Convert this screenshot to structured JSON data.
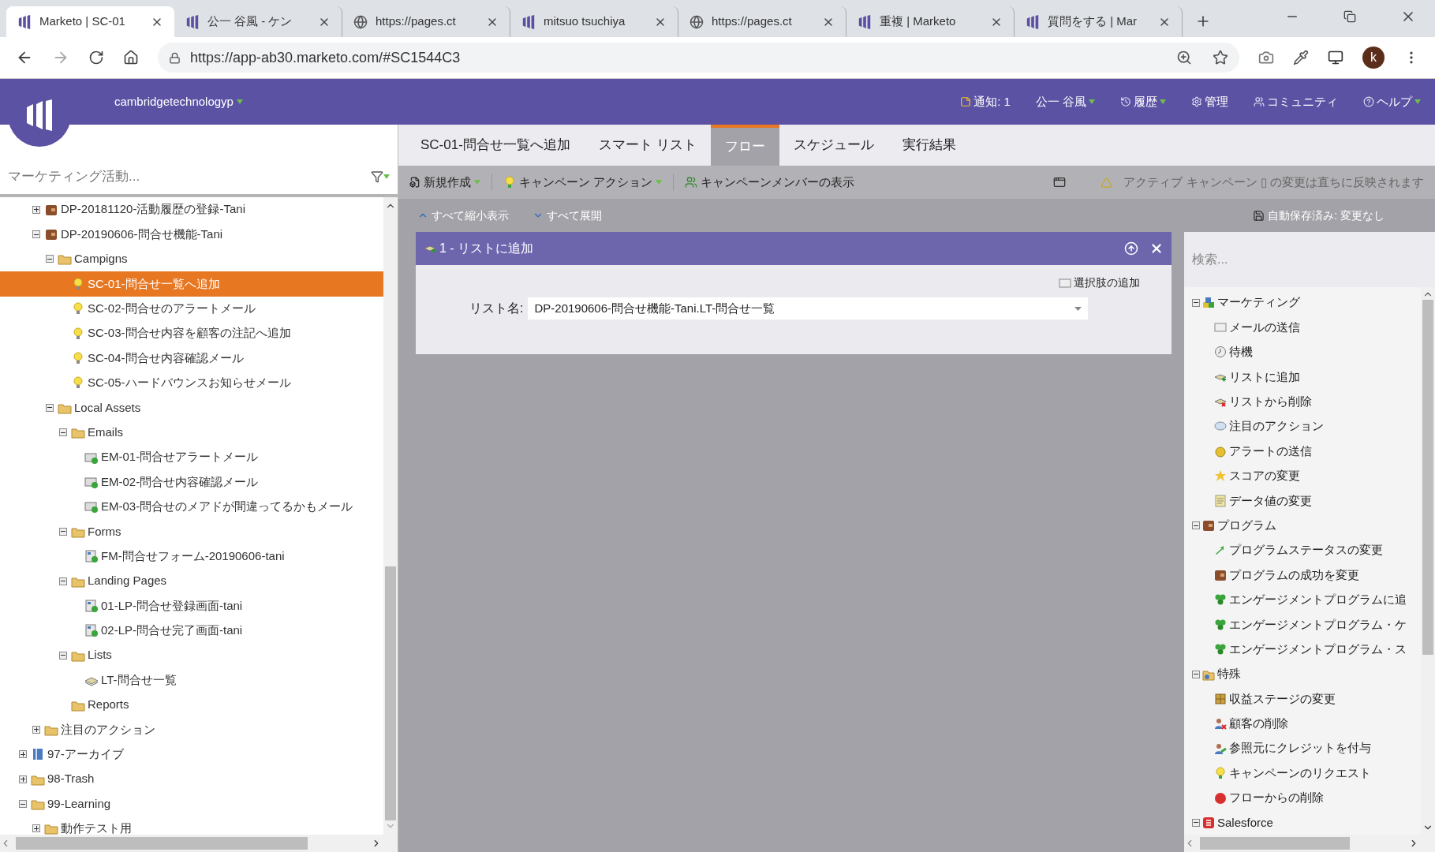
{
  "browser": {
    "tabs": [
      {
        "title": "Marketo | SC-01",
        "kind": "marketo",
        "selected": true
      },
      {
        "title": "公一 谷風 - ケン",
        "kind": "marketo",
        "selected": false
      },
      {
        "title": "https://pages.ct",
        "kind": "web",
        "selected": false
      },
      {
        "title": "mitsuo tsuchiya",
        "kind": "marketo",
        "selected": false
      },
      {
        "title": "https://pages.ct",
        "kind": "web",
        "selected": false
      },
      {
        "title": "重複 | Marketo",
        "kind": "marketo",
        "selected": false
      },
      {
        "title": "質問をする | Mar",
        "kind": "marketo",
        "selected": false
      }
    ],
    "url": "https://app-ab30.marketo.com/#SC1544C3",
    "profile": "k"
  },
  "header": {
    "workspace": "cambridgetechnologyp",
    "menu": [
      {
        "label": "通知: 1",
        "kind": "notifications"
      },
      {
        "label": "公一 谷風",
        "kind": "user"
      },
      {
        "label": "履歴",
        "kind": "history"
      },
      {
        "label": "管理",
        "kind": "admin"
      },
      {
        "label": "コミュニティ",
        "kind": "community"
      },
      {
        "label": "ヘルプ",
        "kind": "help"
      }
    ]
  },
  "tree": {
    "search_placeholder": "マーケティング活動...",
    "continued": [
      {
        "label": "DP-20181120-活動履歴の登録-Tani",
        "kind": "program",
        "expanded": false,
        "selected": false
      },
      {
        "label": "DP-20190606-問合せ機能-Tani",
        "kind": "program",
        "expanded": true,
        "selected": false,
        "children": [
          {
            "label": "Campigns",
            "kind": "folder",
            "expanded": true,
            "selected": false,
            "children": [
              {
                "label": "SC-01-問合せ一覧へ追加",
                "kind": "campaign",
                "selected": true
              },
              {
                "label": "SC-02-問合せのアラートメール",
                "kind": "campaign",
                "selected": false
              },
              {
                "label": "SC-03-問合せ内容を顧客の注記へ追加",
                "kind": "campaign",
                "selected": false
              },
              {
                "label": "SC-04-問合せ内容確認メール",
                "kind": "campaign",
                "selected": false
              },
              {
                "label": "SC-05-ハードバウンスお知らせメール",
                "kind": "campaign",
                "selected": false
              }
            ]
          },
          {
            "label": "Local Assets",
            "kind": "folder",
            "expanded": true,
            "selected": false,
            "children": [
              {
                "label": "Emails",
                "kind": "folder",
                "expanded": true,
                "selected": false,
                "children": [
                  {
                    "label": "EM-01-問合せアラートメール",
                    "kind": "email",
                    "selected": false
                  },
                  {
                    "label": "EM-02-問合せ内容確認メール",
                    "kind": "email",
                    "selected": false
                  },
                  {
                    "label": "EM-03-問合せのメアドが間違ってるかもメール",
                    "kind": "email",
                    "selected": false
                  }
                ]
              },
              {
                "label": "Forms",
                "kind": "folder",
                "expanded": true,
                "selected": false,
                "children": [
                  {
                    "label": "FM-問合せフォーム-20190606-tani",
                    "kind": "form",
                    "selected": false
                  }
                ]
              },
              {
                "label": "Landing Pages",
                "kind": "folder",
                "expanded": true,
                "selected": false,
                "children": [
                  {
                    "label": "01-LP-問合せ登録画面-tani",
                    "kind": "form",
                    "selected": false
                  },
                  {
                    "label": "02-LP-問合せ完了画面-tani",
                    "kind": "form",
                    "selected": false
                  }
                ]
              },
              {
                "label": "Lists",
                "kind": "folder",
                "expanded": true,
                "selected": false,
                "children": [
                  {
                    "label": "LT-問合せ一覧",
                    "kind": "list",
                    "selected": false
                  }
                ]
              },
              {
                "label": "Reports",
                "kind": "folder",
                "selected": false
              }
            ]
          }
        ]
      },
      {
        "label": "注目のアクション",
        "kind": "folder",
        "expanded": false,
        "selected": false
      }
    ],
    "items": [
      {
        "label": "97-アーカイブ",
        "kind": "archive",
        "expanded": false,
        "selected": false
      },
      {
        "label": "98-Trash",
        "kind": "folder",
        "expanded": false,
        "selected": false
      },
      {
        "label": "99-Learning",
        "kind": "folder",
        "expanded": true,
        "selected": false,
        "children": [
          {
            "label": "動作テスト用",
            "kind": "folder",
            "expanded": false,
            "selected": false
          }
        ]
      }
    ]
  },
  "tabs": [
    {
      "label": "SC-01-問合せ一覧へ追加",
      "selected": false
    },
    {
      "label": "スマート リスト",
      "selected": false
    },
    {
      "label": "フロー",
      "selected": true
    },
    {
      "label": "スケジュール",
      "selected": false
    },
    {
      "label": "実行結果",
      "selected": false
    }
  ],
  "toolbar": {
    "buttons": [
      {
        "label": "新規作成",
        "kind": "new"
      },
      {
        "label": "キャンペーン アクション",
        "kind": "actions"
      },
      {
        "label": "キャンペーンメンバーの表示",
        "kind": "members"
      }
    ],
    "notice": "アクティブ キャンペーン ▯ の変更は直ちに反映されます"
  },
  "subtoolbar": {
    "collapse": "すべて縮小表示",
    "expand": "すべて展開",
    "saved": "自動保存済み: 変更なし"
  },
  "flow_step": {
    "title": "1 - リストに追加",
    "add_choice": "選択肢の追加",
    "field_label": "リスト名:",
    "field_value": "DP-20190606-問合せ機能-Tani.LT-問合せ一覧"
  },
  "palette": {
    "search_placeholder": "検索...",
    "groups": [
      {
        "label": "マーケティング",
        "kind": "blocks",
        "expanded": true,
        "items": [
          {
            "label": "メールの送信",
            "kind": "email"
          },
          {
            "label": "待機",
            "kind": "clock"
          },
          {
            "label": "リストに追加",
            "kind": "list-add"
          },
          {
            "label": "リストから削除",
            "kind": "list-remove"
          },
          {
            "label": "注目のアクション",
            "kind": "bubble"
          },
          {
            "label": "アラートの送信",
            "kind": "alert"
          },
          {
            "label": "スコアの変更",
            "kind": "star"
          },
          {
            "label": "データ値の変更",
            "kind": "data"
          }
        ]
      },
      {
        "label": "プログラム",
        "kind": "program",
        "expanded": true,
        "items": [
          {
            "label": "プログラムステータスの変更",
            "kind": "arrow"
          },
          {
            "label": "プログラムの成功を変更",
            "kind": "program"
          },
          {
            "label": "エンゲージメントプログラムに追",
            "kind": "engage"
          },
          {
            "label": "エンゲージメントプログラム・ケ",
            "kind": "engage"
          },
          {
            "label": "エンゲージメントプログラム・ス",
            "kind": "engage"
          }
        ]
      },
      {
        "label": "特殊",
        "kind": "special",
        "expanded": true,
        "items": [
          {
            "label": "収益ステージの変更",
            "kind": "revenue"
          },
          {
            "label": "顧客の削除",
            "kind": "person-remove"
          },
          {
            "label": "参照元にクレジットを付与",
            "kind": "person"
          },
          {
            "label": "キャンペーンのリクエスト",
            "kind": "bulb"
          },
          {
            "label": "フローからの削除",
            "kind": "stop"
          }
        ]
      },
      {
        "label": "Salesforce",
        "kind": "salesforce",
        "expanded": true
      }
    ]
  }
}
